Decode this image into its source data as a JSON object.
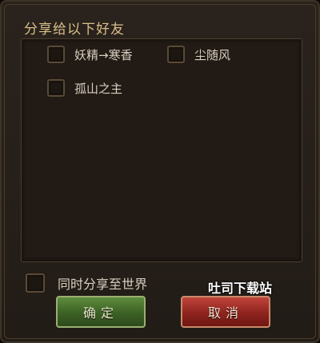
{
  "dialog": {
    "title": "分享给以下好友"
  },
  "friends": [
    {
      "name": "妖精→寒香",
      "checked": false
    },
    {
      "name": "尘随风",
      "checked": false
    },
    {
      "name": "孤山之主",
      "checked": false
    }
  ],
  "share_world": {
    "label": "同时分享至世界",
    "checked": false
  },
  "buttons": {
    "ok_label": "确定",
    "cancel_label": "取消"
  },
  "watermark": {
    "text": "吐司下载站"
  },
  "colors": {
    "title": "#d8bf8a",
    "ok_button": "#3c6125",
    "cancel_button": "#8e231e"
  }
}
